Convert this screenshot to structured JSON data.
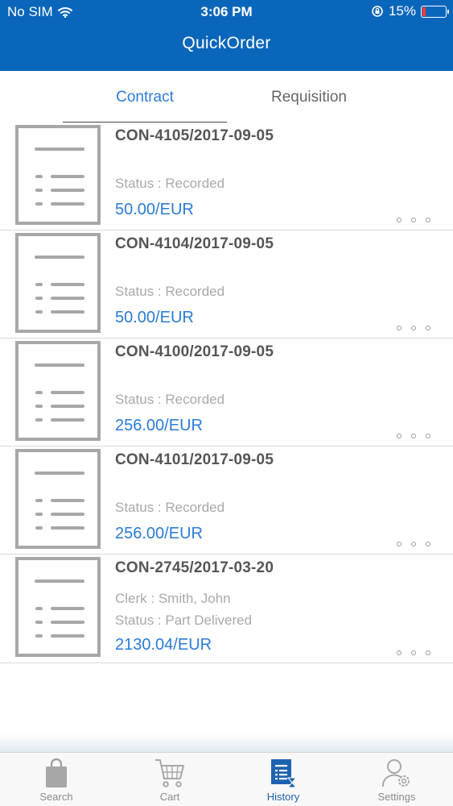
{
  "status_bar": {
    "carrier": "No SIM",
    "time": "3:06 PM",
    "battery_percent": "15%",
    "battery_level": 0.15
  },
  "header": {
    "title": "QuickOrder"
  },
  "tabs": [
    {
      "label": "Contract",
      "active": true
    },
    {
      "label": "Requisition",
      "active": false
    }
  ],
  "contracts": [
    {
      "id": "CON-4105/2017-09-05",
      "status": "Status : Recorded",
      "amount": "50.00/EUR"
    },
    {
      "id": "CON-4104/2017-09-05",
      "status": "Status : Recorded",
      "amount": "50.00/EUR"
    },
    {
      "id": "CON-4100/2017-09-05",
      "status": "Status : Recorded",
      "amount": "256.00/EUR"
    },
    {
      "id": "CON-4101/2017-09-05",
      "status": "Status : Recorded",
      "amount": "256.00/EUR"
    },
    {
      "id": "CON-2745/2017-03-20",
      "clerk": "Clerk : Smith, John",
      "status": "Status : Part Delivered",
      "amount": "2130.04/EUR"
    }
  ],
  "bottom_nav": [
    {
      "label": "Search",
      "icon": "shopping-bag-icon",
      "active": false
    },
    {
      "label": "Cart",
      "icon": "cart-icon",
      "active": false
    },
    {
      "label": "History",
      "icon": "history-document-icon",
      "active": true
    },
    {
      "label": "Settings",
      "icon": "user-settings-icon",
      "active": false
    }
  ],
  "colors": {
    "header_bg": "#0a66ba",
    "accent": "#2a7bd8",
    "nav_active": "#1e63b0",
    "battery_low": "#ff3b30"
  }
}
